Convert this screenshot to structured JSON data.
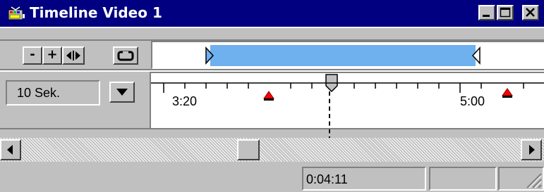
{
  "window": {
    "title": "Timeline Video 1",
    "icon": "timeline-app-icon",
    "controls": [
      "minimize-icon",
      "maximize-icon",
      "close-icon"
    ]
  },
  "toolbar": {
    "buttons": [
      {
        "id": "zoom-out",
        "label": "-"
      },
      {
        "id": "zoom-in",
        "label": "+"
      },
      {
        "id": "fit",
        "icon": "fit-arrows-icon"
      },
      {
        "id": "loop",
        "icon": "loop-icon"
      }
    ]
  },
  "scale": {
    "selected": "10 Sek."
  },
  "ruler": {
    "labels": [
      "3:20",
      "5:00"
    ],
    "markers": 2
  },
  "work_area": {
    "in_marker": "in-point-icon",
    "out_marker": "out-point-icon",
    "highlight_color": "#6fb0ee"
  },
  "status": {
    "time": "0:04:11"
  }
}
